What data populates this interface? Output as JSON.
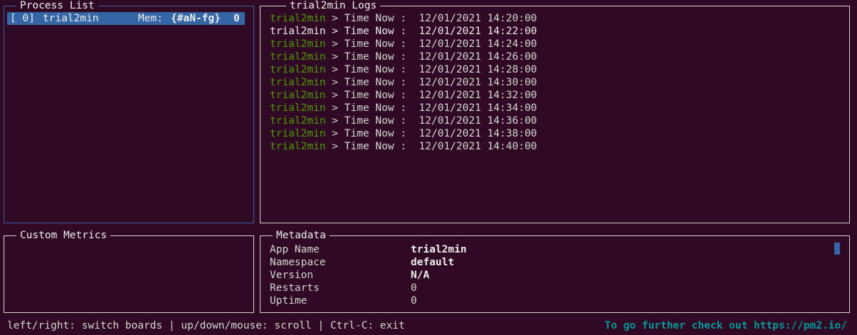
{
  "process_list": {
    "title": "Process List",
    "rows": [
      {
        "id": "[ 0]",
        "name": "trial2min",
        "mem_label": "Mem:",
        "mem_value": "{#aN-fg}",
        "count": "0"
      }
    ]
  },
  "logs": {
    "title": "trial2min Logs",
    "lines": [
      {
        "app": "trial2min",
        "sep": " > ",
        "text": "Time Now :  12/01/2021 14:20:00",
        "highlight": false
      },
      {
        "app": "trial2min",
        "sep": " > ",
        "text": "Time Now :  12/01/2021 14:22:00",
        "highlight": true
      },
      {
        "app": "trial2min",
        "sep": " > ",
        "text": "Time Now :  12/01/2021 14:24:00",
        "highlight": false
      },
      {
        "app": "trial2min",
        "sep": " > ",
        "text": "Time Now :  12/01/2021 14:26:00",
        "highlight": false
      },
      {
        "app": "trial2min",
        "sep": " > ",
        "text": "Time Now :  12/01/2021 14:28:00",
        "highlight": false
      },
      {
        "app": "trial2min",
        "sep": " > ",
        "text": "Time Now :  12/01/2021 14:30:00",
        "highlight": false
      },
      {
        "app": "trial2min",
        "sep": " > ",
        "text": "Time Now :  12/01/2021 14:32:00",
        "highlight": false
      },
      {
        "app": "trial2min",
        "sep": " > ",
        "text": "Time Now :  12/01/2021 14:34:00",
        "highlight": false
      },
      {
        "app": "trial2min",
        "sep": " > ",
        "text": "Time Now :  12/01/2021 14:36:00",
        "highlight": false
      },
      {
        "app": "trial2min",
        "sep": " > ",
        "text": "Time Now :  12/01/2021 14:38:00",
        "highlight": false
      },
      {
        "app": "trial2min",
        "sep": " > ",
        "text": "Time Now :  12/01/2021 14:40:00",
        "highlight": false
      }
    ]
  },
  "custom_metrics": {
    "title": "Custom Metrics"
  },
  "metadata": {
    "title": "Metadata",
    "fields": [
      {
        "label": "App Name",
        "value": "trial2min",
        "bold": true
      },
      {
        "label": "Namespace",
        "value": "default",
        "bold": true
      },
      {
        "label": "Version",
        "value": "N/A",
        "bold": true
      },
      {
        "label": "Restarts",
        "value": "0",
        "bold": false
      },
      {
        "label": "Uptime",
        "value": "0",
        "bold": false
      }
    ]
  },
  "footer": {
    "help": "left/right: switch boards | up/down/mouse: scroll | Ctrl-C: exit",
    "promo": "To go further check out https://pm2.io/"
  },
  "colors": {
    "background": "#300a24",
    "selection": "#3465a4",
    "log_app": "#4e9a06",
    "promo": "#06989a"
  }
}
